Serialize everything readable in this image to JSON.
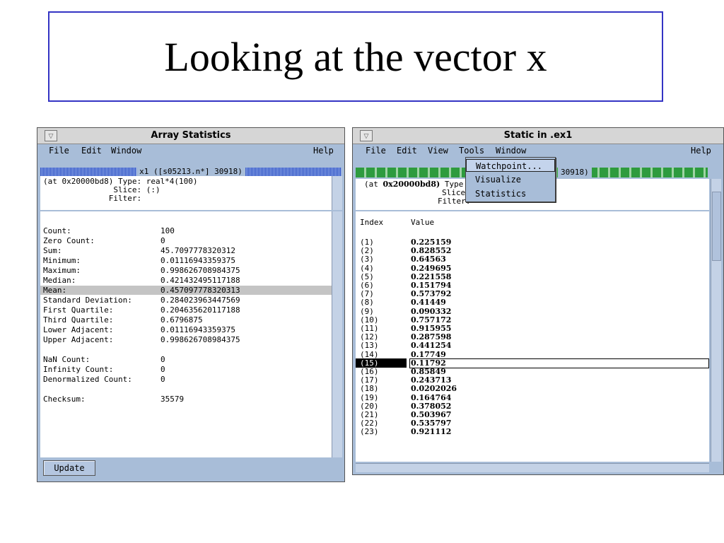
{
  "slide": {
    "title": "Looking at the vector x"
  },
  "left_window": {
    "title": "Array Statistics",
    "menu": {
      "file": "File",
      "edit": "Edit",
      "window": "Window",
      "help": "Help"
    },
    "header_label": "x1 ([s05213.n*] 30918)",
    "info_lines": [
      "(at 0x20000bd8) Type: real*4(100)",
      "               Slice: (:)",
      "              Filter:"
    ],
    "stats": [
      {
        "label": "Count:",
        "value": "100"
      },
      {
        "label": "Zero Count:",
        "value": "0"
      },
      {
        "label": "Sum:",
        "value": "45.7097778320312"
      },
      {
        "label": "Minimum:",
        "value": "0.01116943359375"
      },
      {
        "label": "Maximum:",
        "value": "0.998626708984375"
      },
      {
        "label": "Median:",
        "value": "0.421432495117188"
      },
      {
        "label": "Mean:",
        "value": "0.457097778320313",
        "highlight": true
      },
      {
        "label": "Standard Deviation:",
        "value": "0.284023963447569"
      },
      {
        "label": "First Quartile:",
        "value": "0.204635620117188"
      },
      {
        "label": "Third Quartile:",
        "value": "0.6796875"
      },
      {
        "label": "Lower Adjacent:",
        "value": "0.01116943359375"
      },
      {
        "label": "Upper Adjacent:",
        "value": "0.998626708984375"
      }
    ],
    "stats2": [
      {
        "label": "NaN Count:",
        "value": "0"
      },
      {
        "label": "Infinity Count:",
        "value": "0"
      },
      {
        "label": "Denormalized Count:",
        "value": "0"
      }
    ],
    "checksum": {
      "label": "Checksum:",
      "value": "35579"
    },
    "update_button": "Update"
  },
  "right_window": {
    "title": "Static in .ex1",
    "menu": {
      "file": "File",
      "edit": "Edit",
      "view": "View",
      "tools": "Tools",
      "window": "Window",
      "help": "Help"
    },
    "header_tail": "30918)",
    "info": {
      "at": "(at ",
      "addr": "0x20000bd8)",
      "type": " Type",
      "slice": "Slice",
      "filter": "Filter:"
    },
    "columns": {
      "index": "Index",
      "value": "Value"
    },
    "rows": [
      {
        "index": "(1)",
        "value": "0.225159"
      },
      {
        "index": "(2)",
        "value": "0.828552"
      },
      {
        "index": "(3)",
        "value": "0.64563"
      },
      {
        "index": "(4)",
        "value": "0.249695"
      },
      {
        "index": "(5)",
        "value": "0.221558"
      },
      {
        "index": "(6)",
        "value": "0.151794"
      },
      {
        "index": "(7)",
        "value": "0.573792"
      },
      {
        "index": "(8)",
        "value": "0.41449"
      },
      {
        "index": "(9)",
        "value": "0.090332"
      },
      {
        "index": "(10)",
        "value": "0.757172"
      },
      {
        "index": "(11)",
        "value": "0.915955"
      },
      {
        "index": "(12)",
        "value": "0.287598"
      },
      {
        "index": "(13)",
        "value": "0.441254"
      },
      {
        "index": "(14)",
        "value": "0.17749"
      },
      {
        "index": "(15)",
        "value": "0.11792",
        "selected": true
      },
      {
        "index": "(16)",
        "value": "0.85849"
      },
      {
        "index": "(17)",
        "value": "0.243713"
      },
      {
        "index": "(18)",
        "value": "0.0202026"
      },
      {
        "index": "(19)",
        "value": "0.164764"
      },
      {
        "index": "(20)",
        "value": "0.378052"
      },
      {
        "index": "(21)",
        "value": "0.503967"
      },
      {
        "index": "(22)",
        "value": "0.535797"
      },
      {
        "index": "(23)",
        "value": "0.921112"
      }
    ],
    "tools_menu": [
      {
        "label": "Watchpoint...",
        "selected": true
      },
      {
        "label": "Visualize"
      },
      {
        "label": "Statistics"
      }
    ]
  }
}
